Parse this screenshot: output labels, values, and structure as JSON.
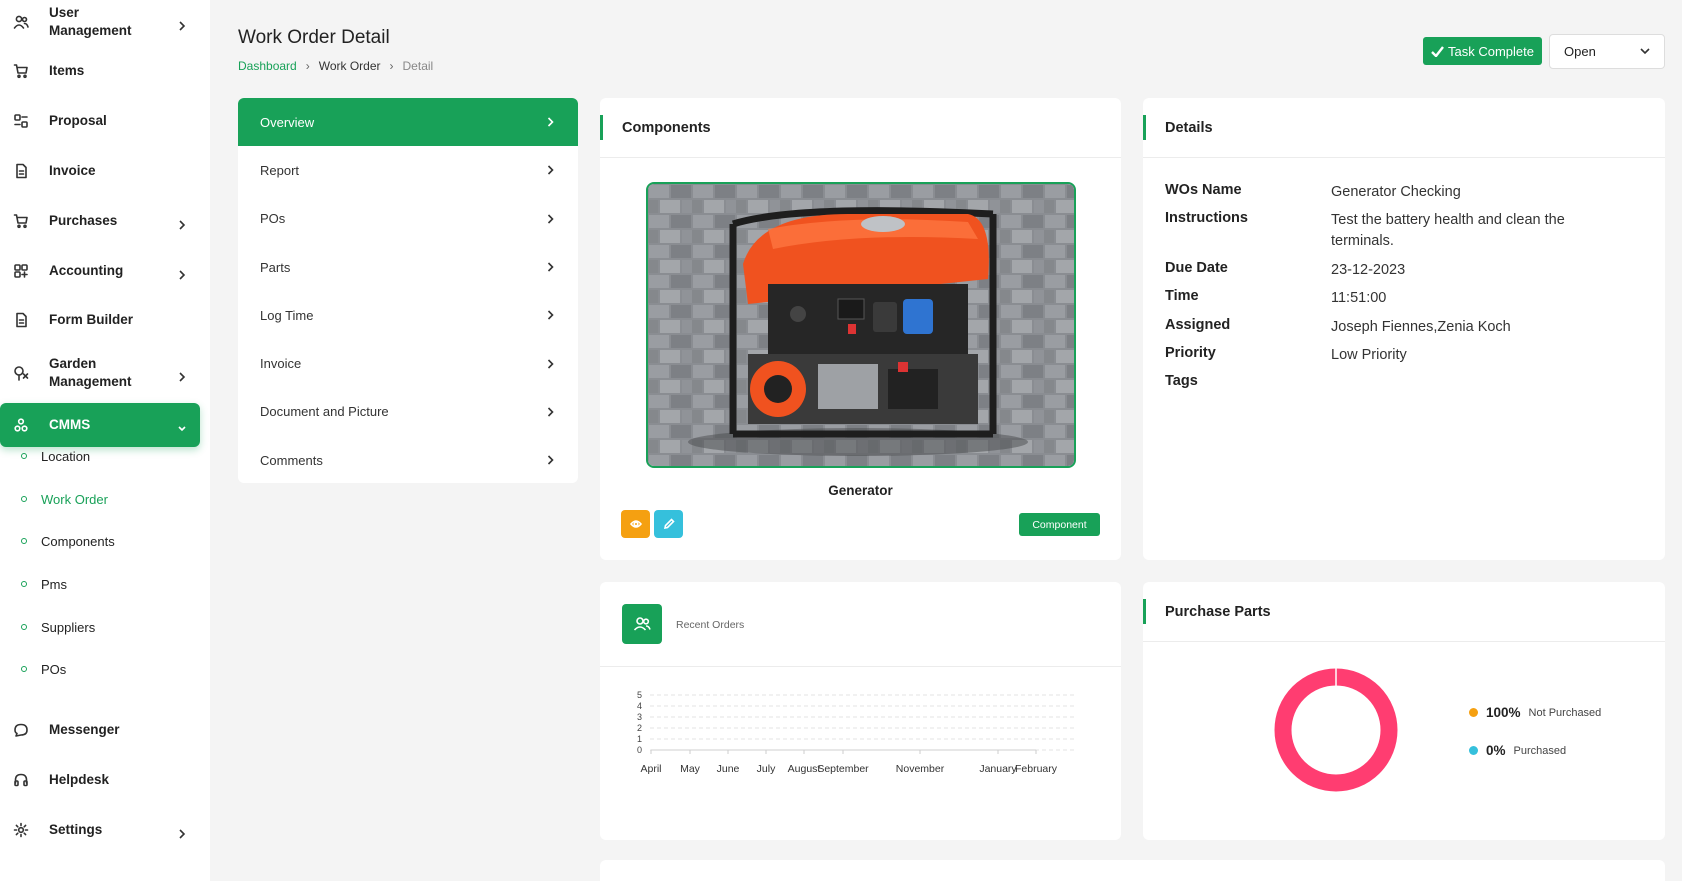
{
  "sidebar": {
    "items": [
      {
        "label": "User Management",
        "icon": "users-icon",
        "has_chevron": true
      },
      {
        "label": "Items",
        "icon": "cart-icon",
        "has_chevron": false
      },
      {
        "label": "Proposal",
        "icon": "proposal-icon",
        "has_chevron": false
      },
      {
        "label": "Invoice",
        "icon": "file-icon",
        "has_chevron": false
      },
      {
        "label": "Purchases",
        "icon": "cart-icon",
        "has_chevron": true
      },
      {
        "label": "Accounting",
        "icon": "grid-icon",
        "has_chevron": true
      },
      {
        "label": "Form Builder",
        "icon": "file-icon",
        "has_chevron": false
      },
      {
        "label": "Garden Management",
        "icon": "tree-icon",
        "has_chevron": true
      },
      {
        "label": "CMMS",
        "icon": "cmms-icon",
        "has_chevron": true,
        "active": true
      },
      {
        "label": "Messenger",
        "icon": "chat-icon",
        "has_chevron": false
      },
      {
        "label": "Helpdesk",
        "icon": "headset-icon",
        "has_chevron": false
      },
      {
        "label": "Settings",
        "icon": "gear-icon",
        "has_chevron": true
      }
    ],
    "cmms_sub": [
      {
        "label": "Location"
      },
      {
        "label": "Work Order",
        "active": true
      },
      {
        "label": "Components"
      },
      {
        "label": "Pms"
      },
      {
        "label": "Suppliers"
      },
      {
        "label": "POs"
      }
    ]
  },
  "header": {
    "title": "Work Order Detail",
    "breadcrumb": [
      "Dashboard",
      "Work Order",
      "Detail"
    ],
    "task_complete_label": "Task Complete",
    "status_value": "Open"
  },
  "tabs": [
    {
      "label": "Overview",
      "active": true
    },
    {
      "label": "Report"
    },
    {
      "label": "POs"
    },
    {
      "label": "Parts"
    },
    {
      "label": "Log Time"
    },
    {
      "label": "Invoice"
    },
    {
      "label": "Document and Picture"
    },
    {
      "label": "Comments"
    }
  ],
  "components": {
    "title": "Components",
    "name": "Generator",
    "component_button": "Component"
  },
  "details": {
    "title": "Details",
    "rows": [
      {
        "key": "WOs Name",
        "value": "Generator Checking"
      },
      {
        "key": "Instructions",
        "value": "Test the battery health and clean the terminals."
      },
      {
        "key": "Due Date",
        "value": "23-12-2023"
      },
      {
        "key": "Time",
        "value": "11:51:00"
      },
      {
        "key": "Assigned",
        "value": "Joseph Fiennes,Zenia Koch"
      },
      {
        "key": "Priority",
        "value": "Low Priority"
      },
      {
        "key": "Tags",
        "value": ""
      }
    ]
  },
  "recent_orders": {
    "label": "Recent Orders"
  },
  "purchase_parts": {
    "title": "Purchase Parts",
    "legend": [
      {
        "pct": "100%",
        "text": "Not Purchased",
        "color": "#f5a011"
      },
      {
        "pct": "0%",
        "text": "Purchased",
        "color": "#35c0dc"
      }
    ]
  },
  "colors": {
    "accent": "#18a158",
    "donut": "#ff3d71"
  },
  "chart_data": {
    "type": "line",
    "categories": [
      "April",
      "May",
      "June",
      "July",
      "August",
      "September",
      "November",
      "January",
      "February"
    ],
    "series": [
      {
        "values": [
          0,
          0,
          0,
          0,
          0,
          0,
          0,
          0,
          0
        ]
      }
    ],
    "yticks": [
      "0",
      "1",
      "2",
      "3",
      "4",
      "5"
    ],
    "ylim": [
      0,
      5
    ],
    "grid": true
  }
}
